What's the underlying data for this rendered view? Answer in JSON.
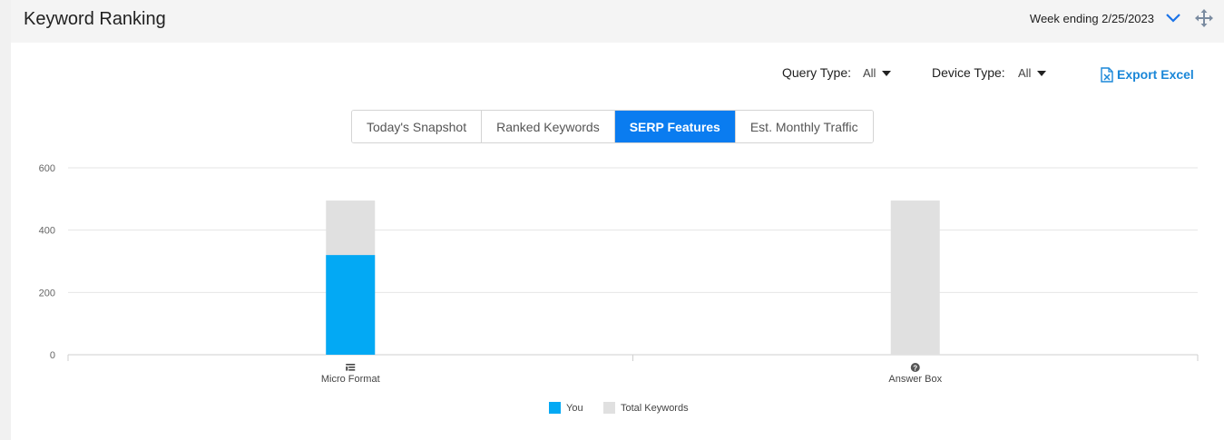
{
  "header": {
    "title": "Keyword Ranking",
    "week_label": "Week ending 2/25/2023"
  },
  "filters": {
    "query_type_label": "Query Type:",
    "query_type_value": "All",
    "device_type_label": "Device Type:",
    "device_type_value": "All",
    "export_label": "Export Excel"
  },
  "tabs": [
    {
      "label": "Today's Snapshot",
      "active": false
    },
    {
      "label": "Ranked Keywords",
      "active": false
    },
    {
      "label": "SERP Features",
      "active": true
    },
    {
      "label": "Est. Monthly Traffic",
      "active": false
    }
  ],
  "colors": {
    "you": "#03a9f4",
    "total": "#e0e0e0",
    "accent": "#0a7cf0",
    "export": "#1a87d8"
  },
  "chart_data": {
    "type": "bar",
    "stacked": true,
    "categories": [
      "Micro Format",
      "Answer Box"
    ],
    "category_icons": [
      "list-icon",
      "question-circle-icon"
    ],
    "series": [
      {
        "name": "You",
        "values": [
          320,
          0
        ]
      },
      {
        "name": "Total Keywords",
        "values": [
          495,
          495
        ]
      }
    ],
    "yticks": [
      0,
      200,
      400,
      600
    ],
    "ylim": [
      0,
      600
    ],
    "grid": true,
    "legend": "bottom-center"
  }
}
